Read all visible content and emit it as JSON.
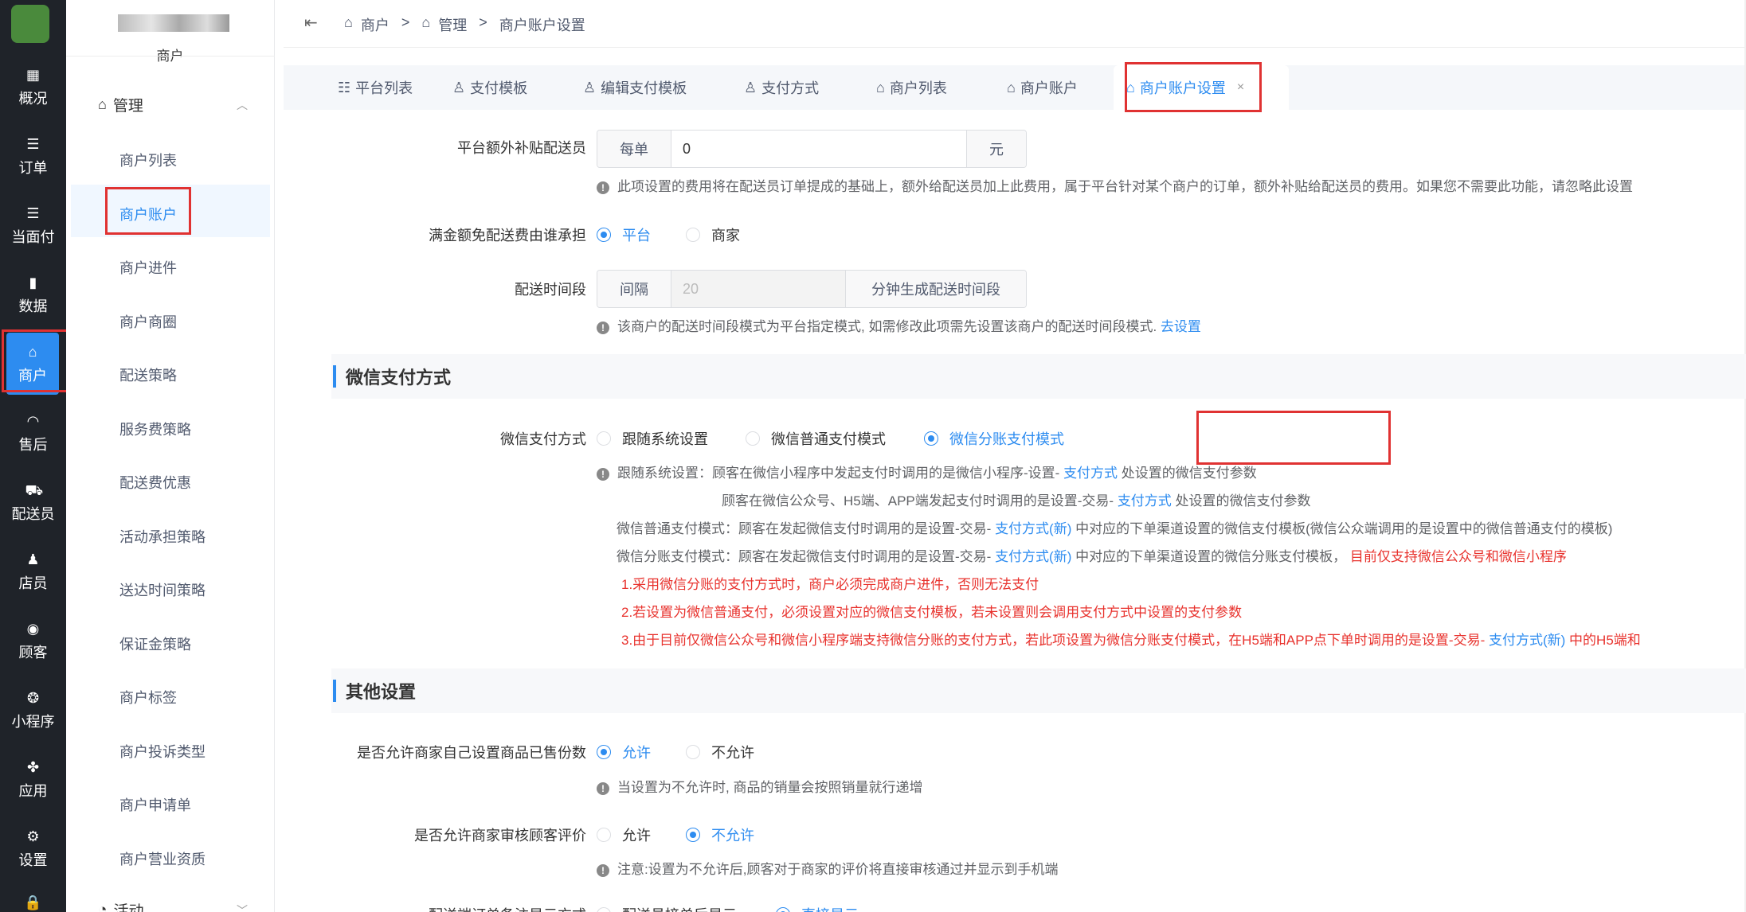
{
  "rail": {
    "items": [
      {
        "label": "概况",
        "icon": "grid-icon"
      },
      {
        "label": "订单",
        "icon": "list-icon"
      },
      {
        "label": "当面付",
        "icon": "list-icon"
      },
      {
        "label": "数据",
        "icon": "bar-chart-icon"
      },
      {
        "label": "商户",
        "icon": "store-icon",
        "active": true
      },
      {
        "label": "售后",
        "icon": "headset-icon"
      },
      {
        "label": "配送员",
        "icon": "scooter-icon"
      },
      {
        "label": "店员",
        "icon": "users-icon"
      },
      {
        "label": "顾客",
        "icon": "customer-icon"
      },
      {
        "label": "小程序",
        "icon": "wechat-icon"
      },
      {
        "label": "应用",
        "icon": "apps-icon"
      },
      {
        "label": "设置",
        "icon": "settings-icon"
      }
    ]
  },
  "submenu": {
    "shop_label": "商户",
    "group": "管理",
    "items": [
      "商户列表",
      "商户账户",
      "商户进件",
      "商户商圈",
      "配送策略",
      "服务费策略",
      "配送费优惠",
      "活动承担策略",
      "送达时间策略",
      "保证金策略",
      "商户标签",
      "商户投诉类型",
      "商户申请单",
      "商户营业资质"
    ],
    "next_group": "活动"
  },
  "breadcrumb": [
    "商户",
    "管理",
    "商户账户设置"
  ],
  "tabs": [
    "平台列表",
    "支付模板",
    "编辑支付模板",
    "支付方式",
    "商户列表",
    "商户账户",
    "商户账户设置"
  ],
  "form": {
    "platform_subsidy": {
      "label": "平台额外补贴配送员",
      "prefix": "每单",
      "value": "0",
      "suffix": "元",
      "help": "此项设置的费用将在配送员订单提成的基础上，额外给配送员加上此费用，属于平台针对某个商户的订单，额外补贴给配送员的费用。如果您不需要此功能，请忽略此设置"
    },
    "free_delivery": {
      "label": "满金额免配送费由谁承担",
      "options": [
        "平台",
        "商家"
      ],
      "selected": "平台"
    },
    "delivery_time": {
      "label": "配送时间段",
      "prefix": "间隔",
      "placeholder": "20",
      "suffix": "分钟生成配送时间段",
      "help": "该商户的配送时间段模式为平台指定模式, 如需修改此项需先设置该商户的配送时间段模式.",
      "help_link": "去设置"
    }
  },
  "wechat_section": {
    "title": "微信支付方式",
    "label": "微信支付方式",
    "options": [
      "跟随系统设置",
      "微信普通支付模式",
      "微信分账支付模式"
    ],
    "selected": "微信分账支付模式",
    "help": {
      "l1_a": "跟随系统设置：顾客在微信小程序中发起支付时调用的是微信小程序-设置-",
      "l1_link": "支付方式",
      "l1_b": "处设置的微信支付参数",
      "l2_a": "顾客在微信公众号、H5端、APP端发起支付时调用的是设置-交易-",
      "l2_link": "支付方式",
      "l2_b": "处设置的微信支付参数",
      "l3_a": "微信普通支付模式：顾客在发起微信支付时调用的是设置-交易-",
      "l3_link": "支付方式(新)",
      "l3_b": "中对应的下单渠道设置的微信支付模板(微信公众端调用的是设置中的微信普通支付的模板)",
      "l4_a": "微信分账支付模式：顾客在发起微信支付时调用的是设置-交易-",
      "l4_link": "支付方式(新)",
      "l4_b": "中对应的下单渠道设置的微信分账支付模板，",
      "l4_red": "目前仅支持微信公众号和微信小程序",
      "r1": "1.采用微信分账的支付方式时，商户必须完成商户进件，否则无法支付",
      "r2": "2.若设置为微信普通支付，必须设置对应的微信支付模板，若未设置则会调用支付方式中设置的支付参数",
      "r3_a": "3.由于目前仅微信公众号和微信小程序端支持微信分账的支付方式，若此项设置为微信分账支付模式，在H5端和APP点下单时调用的是设置-交易-",
      "r3_link": "支付方式(新)",
      "r3_b": "中的H5端和"
    }
  },
  "other_section": {
    "title": "其他设置",
    "sold_count": {
      "label": "是否允许商家自己设置商品已售份数",
      "options": [
        "允许",
        "不允许"
      ],
      "selected": "允许",
      "help": "当设置为不允许时, 商品的销量会按照销量就行递增"
    },
    "review": {
      "label": "是否允许商家审核顾客评价",
      "options": [
        "允许",
        "不允许"
      ],
      "selected": "不允许",
      "help": "注意:设置为不允许后,顾客对于商家的评价将直接审核通过并显示到手机端"
    },
    "note_row": {
      "label": "配送端订单备注显示方式",
      "options": [
        "配送员接单后显示",
        "直接显示"
      ],
      "selected": "直接显示"
    }
  }
}
